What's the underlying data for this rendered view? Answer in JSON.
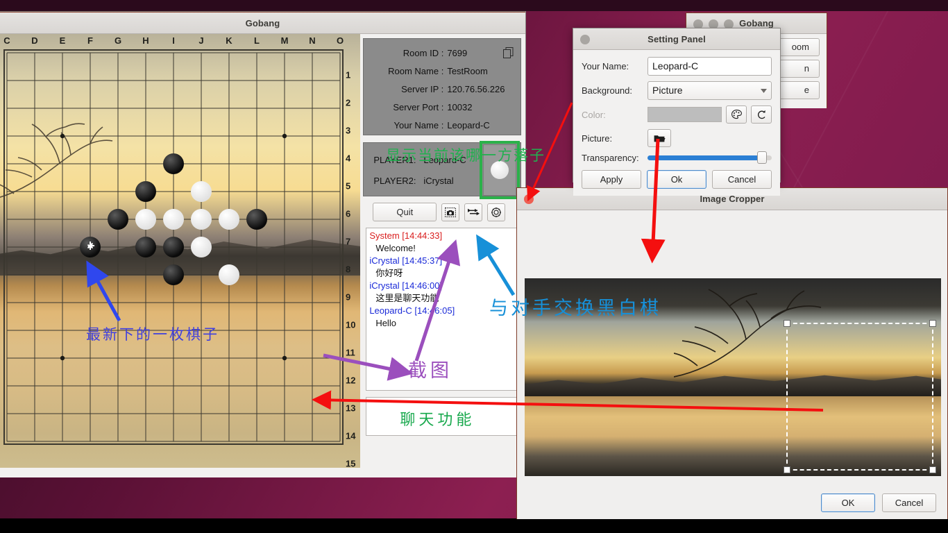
{
  "desktop": {
    "name": "ubuntu-desktop"
  },
  "gobang_window": {
    "title": "Gobang",
    "board": {
      "columns": [
        "C",
        "D",
        "E",
        "F",
        "G",
        "H",
        "I",
        "J",
        "K",
        "L",
        "M",
        "N",
        "O"
      ],
      "rows": [
        "1",
        "2",
        "3",
        "4",
        "5",
        "6",
        "7",
        "8",
        "9",
        "10",
        "11",
        "12",
        "13",
        "14",
        "15"
      ],
      "stones": [
        {
          "col": "I",
          "row": "5",
          "color": "black"
        },
        {
          "col": "H",
          "row": "6",
          "color": "black"
        },
        {
          "col": "J",
          "row": "6",
          "color": "white"
        },
        {
          "col": "G",
          "row": "7",
          "color": "black"
        },
        {
          "col": "H",
          "row": "7",
          "color": "white"
        },
        {
          "col": "I",
          "row": "7",
          "color": "white"
        },
        {
          "col": "J",
          "row": "7",
          "color": "white"
        },
        {
          "col": "K",
          "row": "7",
          "color": "white"
        },
        {
          "col": "L",
          "row": "7",
          "color": "black"
        },
        {
          "col": "F",
          "row": "8",
          "color": "black",
          "cursor": true
        },
        {
          "col": "H",
          "row": "8",
          "color": "black"
        },
        {
          "col": "I",
          "row": "8",
          "color": "black"
        },
        {
          "col": "J",
          "row": "8",
          "color": "white"
        },
        {
          "col": "I",
          "row": "9",
          "color": "black"
        },
        {
          "col": "K",
          "row": "9",
          "color": "white"
        }
      ]
    },
    "info": {
      "room_id_label": "Room  ID :",
      "room_id_value": "7699",
      "room_name_label": "Room Name :",
      "room_name_value": "TestRoom",
      "server_ip_label": "Server IP :",
      "server_ip_value": "120.76.56.226",
      "server_port_label": "Server Port :",
      "server_port_value": "10032",
      "your_name_label": "Your Name :",
      "your_name_value": "Leopard-C",
      "copy_icon": "copy-icon"
    },
    "players": {
      "player1_label": "PLAYER1:",
      "player1_value": "Leopard-C",
      "player2_label": "PLAYER2:",
      "player2_value": "iCrystal",
      "turn_stone_color": "white",
      "turn_highlight_color": "#2bb14a"
    },
    "toolbar": {
      "quit_label": "Quit",
      "screenshot_icon": "camera-icon",
      "swap_icon": "swap-arrows-icon",
      "settings_icon": "gear-icon"
    },
    "chat": {
      "messages": [
        {
          "sender": "System",
          "time": "[14:44:33]",
          "kind": "system",
          "text": "Welcome!"
        },
        {
          "sender": "iCrystal",
          "time": "[14:45:37]",
          "kind": "peer",
          "text": "你好呀"
        },
        {
          "sender": "iCrystal",
          "time": "[14:46:00]",
          "kind": "peer",
          "text": "这里是聊天功能"
        },
        {
          "sender": "Leopard-C",
          "time": "[14:46:05]",
          "kind": "self",
          "text": "Hello"
        }
      ],
      "input_annotation": "聊天功能"
    }
  },
  "gobang_back_window": {
    "title": "Gobang",
    "buttons": [
      "oom",
      "n",
      "e"
    ]
  },
  "setting_panel": {
    "title": "Setting Panel",
    "your_name_label": "Your Name:",
    "your_name_value": "Leopard-C",
    "background_label": "Background:",
    "background_value": "Picture",
    "color_label": "Color:",
    "color_value": "#bdbdbd",
    "palette_icon": "palette-icon",
    "reset_icon": "reset-arrow-icon",
    "picture_label": "Picture:",
    "picture_icon": "folder-open-icon",
    "transparency_label": "Transparency:",
    "transparency_percent": 92,
    "apply_label": "Apply",
    "ok_label": "Ok",
    "cancel_label": "Cancel"
  },
  "image_cropper": {
    "title": "Image Cropper",
    "ok_label": "OK",
    "cancel_label": "Cancel"
  },
  "annotations": [
    {
      "name": "turn-indicator-annotation",
      "text": "显示当前该哪一方落子",
      "color": "#21b04f"
    },
    {
      "name": "swap-annotation",
      "text": "与对手交换黑白棋",
      "color": "#1790d8"
    },
    {
      "name": "screenshot-annotation",
      "text": "截图",
      "color": "#9b4fbd"
    },
    {
      "name": "last-move-annotation",
      "text": "最新下的一枚棋子",
      "color": "#4040dd"
    },
    {
      "name": "chat-annotation",
      "text": "聊天功能",
      "color": "#17a84c"
    }
  ]
}
